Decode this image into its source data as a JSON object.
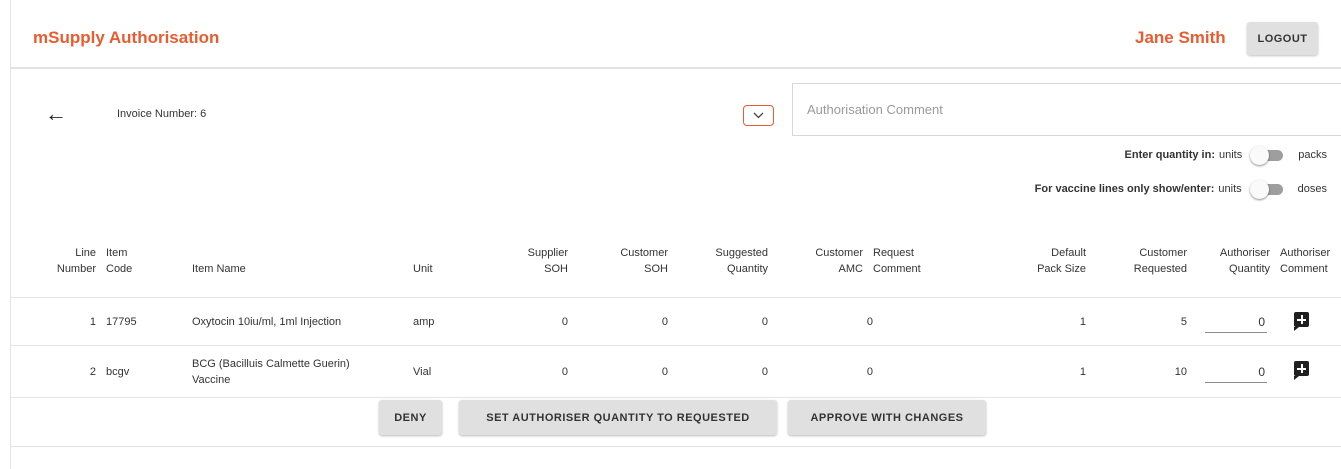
{
  "header": {
    "app_title": "mSupply Authorisation",
    "user_name": "Jane Smith",
    "logout_label": "LOGOUT"
  },
  "info": {
    "back_icon": "arrow-left-icon",
    "invoice_label": "Invoice Number:",
    "invoice_number": "6",
    "comment_toggle_icon": "chevron-down-icon",
    "comment_placeholder": "Authorisation Comment",
    "comment_value": ""
  },
  "options": {
    "quantity": {
      "label": "Enter quantity in:",
      "left_option": "units",
      "right_option": "packs",
      "selected": "units"
    },
    "vaccine": {
      "label": "For vaccine lines only show/enter:",
      "left_option": "units",
      "right_option": "doses",
      "selected": "units"
    }
  },
  "table": {
    "headers": {
      "line_number": [
        "Line",
        "Number"
      ],
      "item_code": [
        "Item",
        "Code"
      ],
      "item_name": "Item Name",
      "unit": "Unit",
      "supplier_soh": [
        "Supplier",
        "SOH"
      ],
      "customer_soh": [
        "Customer",
        "SOH"
      ],
      "suggested_quantity": [
        "Suggested",
        "Quantity"
      ],
      "customer_amc": [
        "Customer",
        "AMC"
      ],
      "request_comment": [
        "Request",
        "Comment"
      ],
      "default_pack_size": [
        "Default",
        "Pack Size"
      ],
      "customer_requested": [
        "Customer",
        "Requested"
      ],
      "authoriser_quantity": [
        "Authoriser",
        "Quantity"
      ],
      "authoriser_comment": [
        "Authoriser",
        "Comment"
      ]
    },
    "rows": [
      {
        "line_number": "1",
        "item_code": "17795",
        "item_name": [
          "Oxytocin 10iu/ml, 1ml Injection"
        ],
        "unit": "amp",
        "supplier_soh": "0",
        "customer_soh": "0",
        "suggested_quantity": "0",
        "customer_amc": "0",
        "request_comment": "",
        "default_pack_size": "1",
        "customer_requested": "5",
        "authoriser_quantity": "0",
        "comment_icon": "add-comment-icon"
      },
      {
        "line_number": "2",
        "item_code": "bcgv",
        "item_name": [
          "BCG (Bacilluis Calmette Guerin)",
          "Vaccine"
        ],
        "unit": "Vial",
        "supplier_soh": "0",
        "customer_soh": "0",
        "suggested_quantity": "0",
        "customer_amc": "0",
        "request_comment": "",
        "default_pack_size": "1",
        "customer_requested": "10",
        "authoriser_quantity": "0",
        "comment_icon": "add-comment-icon"
      }
    ]
  },
  "actions": {
    "deny_label": "DENY",
    "set_quantity_label": "SET AUTHORISER QUANTITY TO REQUESTED",
    "approve_label": "APPROVE WITH CHANGES"
  },
  "colors": {
    "brand": "#e95c30",
    "button_bg": "#e0e0e0",
    "switch_track": "#9e9e9e"
  }
}
